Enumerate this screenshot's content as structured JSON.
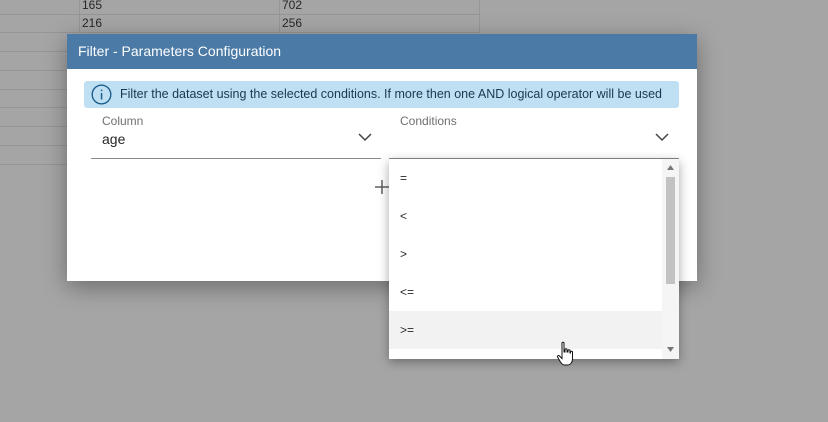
{
  "background_table": {
    "rows": [
      [
        "165",
        "702"
      ],
      [
        "216",
        "256"
      ]
    ]
  },
  "dialog": {
    "title": "Filter - Parameters Configuration",
    "info": "Filter the dataset using the selected conditions. If more then one AND logical operator will be used",
    "column_label": "Column",
    "column_value": "age",
    "conditions_label": "Conditions",
    "conditions_value": ""
  },
  "conditions_dropdown": {
    "options": [
      "=",
      "<",
      ">",
      "<=",
      ">="
    ],
    "hovered": ">="
  },
  "colors": {
    "header": "#4a7aa5",
    "info_bg": "#bfe0f3",
    "overlay": "#a5a5a5"
  }
}
